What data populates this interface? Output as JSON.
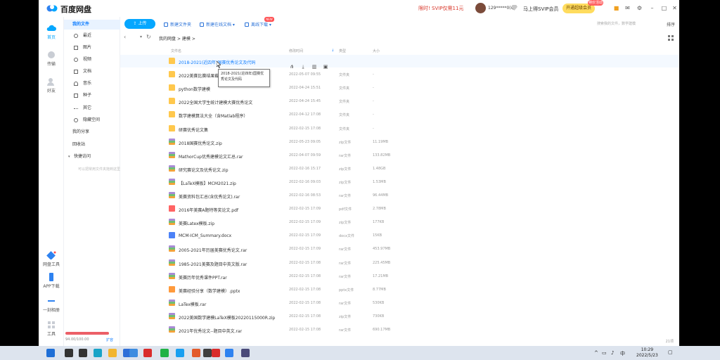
{
  "app": {
    "name": "百度网盘",
    "promo_text": "限时! SVIP仅需11元",
    "user": "129*****0(Q",
    "vip_link": "马上得SVIP会员",
    "vip_button": "开通超级会员",
    "vip_badge": "特价活动"
  },
  "rail": [
    {
      "label": "首页",
      "icon": "cloud-icon"
    },
    {
      "label": "传输",
      "icon": "transfer-icon"
    },
    {
      "label": "好友",
      "icon": "friends-icon"
    },
    {
      "label": "网盘工具",
      "icon": "tools-icon"
    },
    {
      "label": "APP下载",
      "icon": "phone-icon"
    },
    {
      "label": "一刻相册",
      "icon": "album-icon"
    },
    {
      "label": "工具",
      "icon": "apps-icon"
    }
  ],
  "nav": {
    "all_files": "我的文件",
    "items": [
      "最近",
      "图片",
      "视频",
      "文档",
      "音乐",
      "种子",
      "其它"
    ],
    "hidden_space": "隐藏空间",
    "my_share": "我的分享",
    "recycle": "回收站",
    "quick_access": "快捷访问",
    "quick_hint": "可以把常用文件夹拖到这里"
  },
  "storage": {
    "used": "94.00/100.00",
    "expand": "扩容"
  },
  "toolbar": {
    "upload": "上传",
    "new_folder": "新建文件夹",
    "new_online_doc": "新建在线文档",
    "offline_download": "离线下载",
    "new_badge": "NEW",
    "search_hint": "搜索我的文件，数学建模",
    "sort": "排序"
  },
  "breadcrumb": {
    "parts": [
      "我的网盘",
      ">",
      "建模",
      ">"
    ]
  },
  "columns": {
    "name": "文件名",
    "modified": "修改时间",
    "type": "类型",
    "size": "大小"
  },
  "files": [
    {
      "name": "2018-2021(近四年)国赛优秀论文及代码",
      "date": "",
      "type": "",
      "size": "",
      "kind": "folder",
      "hover": true
    },
    {
      "name": "2022美赛比赛结果截图",
      "date": "2022-05-07 09:55",
      "type": "文件夹",
      "size": "-",
      "kind": "folder"
    },
    {
      "name": "python数学建模",
      "date": "2022-04-24 15:51",
      "type": "文件夹",
      "size": "-",
      "kind": "folder"
    },
    {
      "name": "2022全国大学生统计建模大赛优秀论文",
      "date": "2022-04-24 15:45",
      "type": "文件夹",
      "size": "-",
      "kind": "folder"
    },
    {
      "name": "数学建模算法大全（含Matlab程序）",
      "date": "2022-04-12 17:08",
      "type": "文件夹",
      "size": "-",
      "kind": "folder"
    },
    {
      "name": "研赛优秀论文集",
      "date": "2022-02-15 17:08",
      "type": "文件夹",
      "size": "-",
      "kind": "folder"
    },
    {
      "name": "2018国赛优秀论文.zip",
      "date": "2022-05-23 09:05",
      "type": "zip文件",
      "size": "11.19MB",
      "kind": "zip"
    },
    {
      "name": "MathorCup优秀建模论文汇总.rar",
      "date": "2022-04-07 09:59",
      "type": "rar文件",
      "size": "133.82MB",
      "kind": "rar"
    },
    {
      "name": "研究赛论文及优秀论文.zip",
      "date": "2022-02-16 15:17",
      "type": "zip文件",
      "size": "1.48GB",
      "kind": "zip"
    },
    {
      "name": "【LaTeX模板】MCM2021.zip",
      "date": "2022-02-16 09:03",
      "type": "zip文件",
      "size": "1.53MB",
      "kind": "zip"
    },
    {
      "name": "美赛资料包汇总(含优秀论文).rar",
      "date": "2022-02-16 08:53",
      "type": "rar文件",
      "size": "96.44MB",
      "kind": "rar"
    },
    {
      "name": "2016年美赛A题特等奖论文.pdf",
      "date": "2022-02-15 17:09",
      "type": "pdf文件",
      "size": "2.78MB",
      "kind": "pdf"
    },
    {
      "name": "美赛Latex模板.zip",
      "date": "2022-02-15 17:09",
      "type": "zip文件",
      "size": "177KB",
      "kind": "zip"
    },
    {
      "name": "MCM-ICM_Summary.docx",
      "date": "2022-02-15 17:09",
      "type": "docx文件",
      "size": "15KB",
      "kind": "docx"
    },
    {
      "name": "2005-2021年历届美赛优秀论文.rar",
      "date": "2022-02-15 17:09",
      "type": "rar文件",
      "size": "453.97MB",
      "kind": "rar"
    },
    {
      "name": "1985-2021美赛及题目中英文版.rar",
      "date": "2022-02-15 17:08",
      "type": "rar文件",
      "size": "225.45MB",
      "kind": "rar"
    },
    {
      "name": "美赛历年优秀课件PPT.rar",
      "date": "2022-02-15 17:08",
      "type": "rar文件",
      "size": "17.21MB",
      "kind": "rar"
    },
    {
      "name": "美赛经验分享（数学建模）.pptx",
      "date": "2022-02-15 17:08",
      "type": "pptx文件",
      "size": "8.77MB",
      "kind": "pptx"
    },
    {
      "name": "LaTex模板.rar",
      "date": "2022-02-15 17:08",
      "type": "rar文件",
      "size": "530KB",
      "kind": "rar"
    },
    {
      "name": "2022美国数学建模LaTeX模板20220115000R.zip",
      "date": "2022-02-15 17:08",
      "type": "zip文件",
      "size": "730KB",
      "kind": "zip"
    },
    {
      "name": "2021年优秀论文--题目中英文.rar",
      "date": "2022-02-15 17:08",
      "type": "rar文件",
      "size": "690.17MB",
      "kind": "rar"
    }
  ],
  "tooltip": "2018-2021(近四年)国赛优秀论文及代码",
  "footer": {
    "count": "21项"
  },
  "taskbar": {
    "apps": [
      {
        "icon": "windows-start-icon",
        "color": "#1f6fd6"
      },
      {
        "icon": "search-icon",
        "color": "#333333"
      },
      {
        "icon": "task-view-icon",
        "color": "#333333"
      },
      {
        "icon": "edge-icon",
        "color": "#18a3c7"
      },
      {
        "icon": "file-explorer-icon",
        "color": "#f2b530"
      },
      {
        "icon": "mail-icon",
        "color": "#2f6fd8"
      },
      {
        "icon": "pen-icon",
        "color": "#3c8ce0"
      },
      {
        "icon": "netease-music-icon",
        "color": "#d92c2c"
      },
      {
        "icon": "wechat-icon",
        "color": "#20b246"
      },
      {
        "icon": "qq-icon",
        "color": "#1a9ff0"
      },
      {
        "icon": "office-icon",
        "color": "#e35b2c"
      },
      {
        "icon": "terminal-icon",
        "color": "#3f3f3f"
      },
      {
        "icon": "wps-icon",
        "color": "#d92c2c"
      },
      {
        "icon": "baidu-netdisk-icon",
        "color": "#2e82f0"
      },
      {
        "icon": "media-icon",
        "color": "#4a4a7a"
      }
    ],
    "ime": "中",
    "time": "10:29",
    "date": "2022/5/23"
  }
}
